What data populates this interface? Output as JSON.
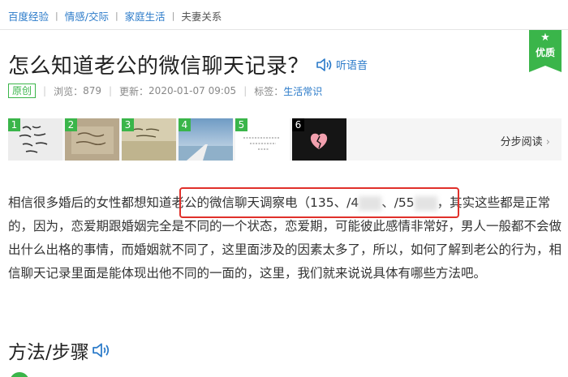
{
  "breadcrumb": {
    "items": [
      "百度经验",
      "情感/交际",
      "家庭生活",
      "夫妻关系"
    ],
    "separator": "|"
  },
  "badge": {
    "label": "优质",
    "icon": "star-icon"
  },
  "article": {
    "title": "怎么知道老公的微信聊天记录？",
    "listen_label": "听语音",
    "original_tag": "原创",
    "views_label": "浏览：",
    "views": "879",
    "updated_label": "更新：",
    "updated": "2020-01-07 09:05",
    "tags_label": "标签：",
    "tag": "生活常识"
  },
  "thumbnails": {
    "items": [
      {
        "num": "1",
        "color": "#3ab54a"
      },
      {
        "num": "2",
        "color": "#3ab54a"
      },
      {
        "num": "3",
        "color": "#3ab54a"
      },
      {
        "num": "4",
        "color": "#3ab54a"
      },
      {
        "num": "5",
        "color": "#3ab54a"
      },
      {
        "num": "6",
        "color": "#000000"
      }
    ],
    "step_read_label": "分步阅读"
  },
  "paragraph": {
    "seg1": "相信很多婚后的女性都想知道",
    "seg2": "老公的微信聊天调察电（135、/4",
    "seg3": "、/55",
    "seg4": "，其实这些都是正常的，因为，恋爱期跟婚姻完全是不同的一个状态，恋爱期，可能彼此感情非常好，男人一般都不会做出什么出格的事情，而婚姻就不同了，这里面涉及的因素太多了，所以，如何了解到老公的行为，相信聊天记录里面是能体现出他不同的一面的，这里，我们就来说说具体有哪些方法吧。"
  },
  "section": {
    "title": "方法/步骤"
  },
  "colors": {
    "link": "#2a7ac9",
    "green": "#3ab54a",
    "highlight_border": "#e0302a"
  }
}
